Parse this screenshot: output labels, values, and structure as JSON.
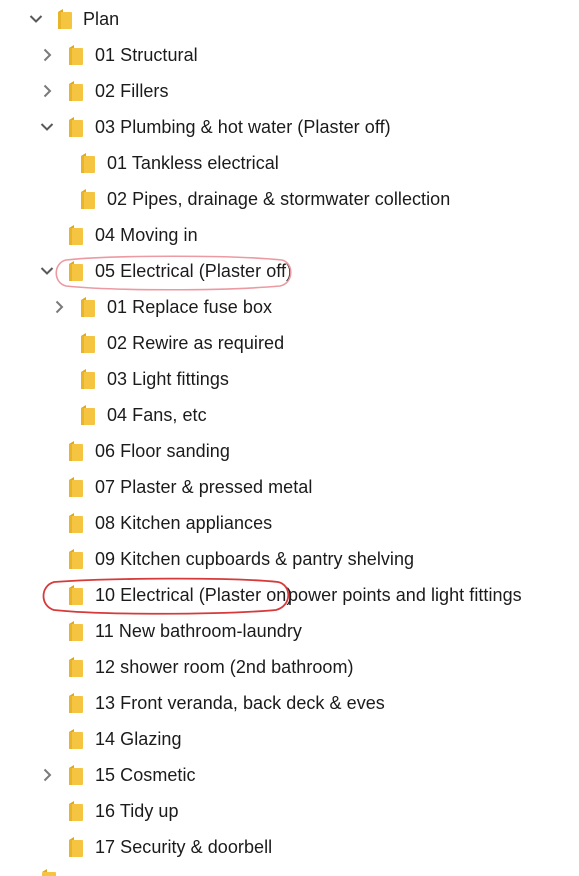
{
  "tree": {
    "icons": {
      "folder": "folder-icon",
      "expand": "chevron-right-icon",
      "collapse": "chevron-down-icon"
    },
    "colors": {
      "folder_fill": "#f5c542",
      "folder_dark": "#e0a81c",
      "chevron": "#6b6b6b",
      "annotation_red": "#d63a3a",
      "annotation_pink": "#ec9aa2"
    },
    "items": [
      {
        "label": "Plan",
        "state": "expanded",
        "level": 0
      },
      {
        "label": "01 Structural",
        "state": "collapsed",
        "level": 1
      },
      {
        "label": "02 Fillers",
        "state": "collapsed",
        "level": 1
      },
      {
        "label": "03 Plumbing & hot water (Plaster off)",
        "state": "expanded",
        "level": 1
      },
      {
        "label": "01 Tankless electrical",
        "state": "none",
        "level": 2
      },
      {
        "label": "02 Pipes, drainage & stormwater collection",
        "state": "none",
        "level": 2
      },
      {
        "label": "04 Moving in",
        "state": "none",
        "level": 1
      },
      {
        "label": "05 Electrical (Plaster off)",
        "state": "expanded",
        "level": 1
      },
      {
        "label": "01 Replace fuse box",
        "state": "collapsed",
        "level": 2
      },
      {
        "label": "02 Rewire as required",
        "state": "none",
        "level": 2
      },
      {
        "label": "03 Light fittings",
        "state": "none",
        "level": 2
      },
      {
        "label": "04 Fans, etc",
        "state": "none",
        "level": 2
      },
      {
        "label": "06 Floor sanding",
        "state": "none",
        "level": 1
      },
      {
        "label": "07 Plaster & pressed metal",
        "state": "none",
        "level": 1
      },
      {
        "label": "08 Kitchen appliances",
        "state": "none",
        "level": 1
      },
      {
        "label": "09 Kitchen cupboards & pantry shelving",
        "state": "none",
        "level": 1
      },
      {
        "label": "10 Electrical (Plaster on)",
        "state": "none",
        "level": 1
      },
      {
        "label": "11 New bathroom-laundry",
        "state": "none",
        "level": 1
      },
      {
        "label": "12 shower room (2nd bathroom)",
        "state": "none",
        "level": 1
      },
      {
        "label": "13 Front veranda, back deck & eves",
        "state": "none",
        "level": 1
      },
      {
        "label": "14 Glazing",
        "state": "none",
        "level": 1
      },
      {
        "label": "15 Cosmetic",
        "state": "collapsed",
        "level": 1
      },
      {
        "label": "16 Tidy up",
        "state": "none",
        "level": 1
      },
      {
        "label": "17 Security & doorbell",
        "state": "none",
        "level": 1
      }
    ]
  },
  "annotations": {
    "handwritten_note": "power points and light fittings"
  }
}
